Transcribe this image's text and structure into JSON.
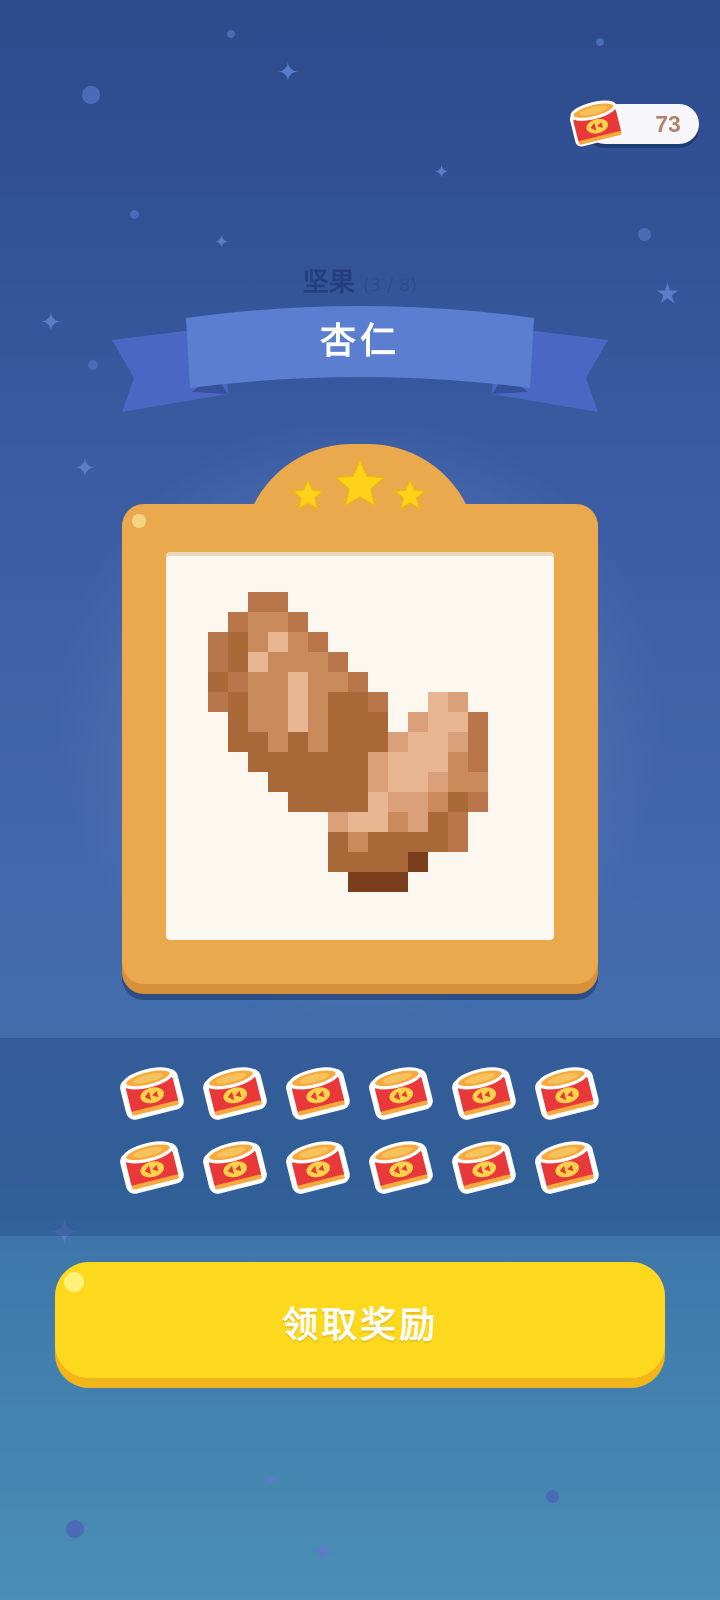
{
  "currency": {
    "icon": "cat-food-can-icon",
    "count": "73"
  },
  "header": {
    "category": "坚果",
    "progress": "(3 / 8)",
    "item_name": "杏仁"
  },
  "rating": {
    "stars": 3,
    "max_stars": 3,
    "icon": "star-icon"
  },
  "artwork": {
    "subject": "almond-pixel-art",
    "palette": [
      "#b8764a",
      "#c98a5c",
      "#a86838",
      "#8c4d26",
      "#d9a07a",
      "#e8b690",
      "#7a3e1c"
    ]
  },
  "reward": {
    "item_icon": "cat-food-can-icon",
    "quantity": 12
  },
  "claim_button": {
    "label": "领取奖励"
  },
  "colors": {
    "background": "#3a5ca2",
    "frame": "#e9a94c",
    "ribbon": "#5b7ed0",
    "button": "#fdd91e",
    "star": "#ffd21a"
  }
}
